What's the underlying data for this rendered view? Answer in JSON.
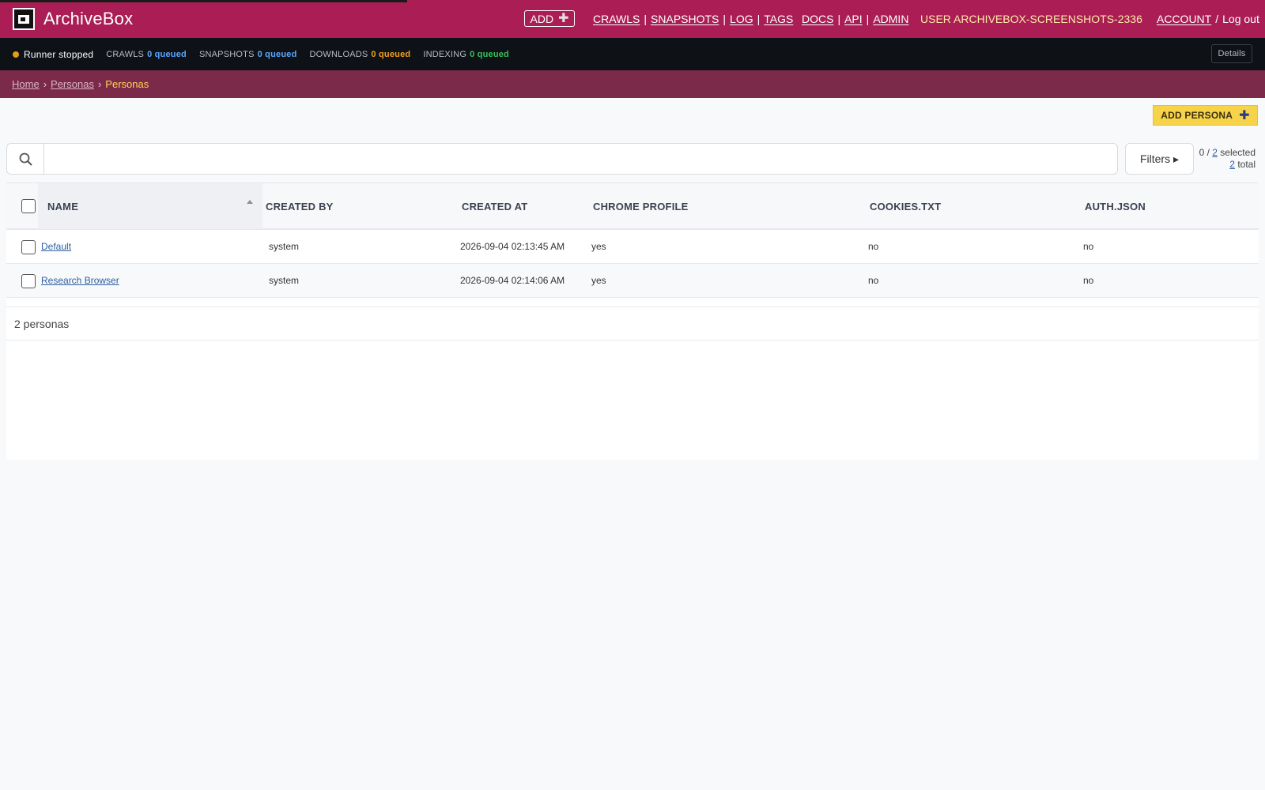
{
  "header": {
    "brand": "ArchiveBox",
    "add_label": "ADD",
    "nav_group1": [
      "CRAWLS",
      "SNAPSHOTS",
      "LOG",
      "TAGS"
    ],
    "nav_group2": [
      "DOCS",
      "API",
      "ADMIN"
    ],
    "user": "USER ARCHIVEBOX-SCREENSHOTS-2336",
    "account": "ACCOUNT",
    "logout_sep": "/",
    "logout": "Log out"
  },
  "status": {
    "runner": "Runner stopped",
    "queues": [
      {
        "label": "CRAWLS",
        "value": "0 queued",
        "color": "#5aa7ff"
      },
      {
        "label": "SNAPSHOTS",
        "value": "0 queued",
        "color": "#5aa7ff"
      },
      {
        "label": "DOWNLOADS",
        "value": "0 queued",
        "color": "#f0a020"
      },
      {
        "label": "INDEXING",
        "value": "0 queued",
        "color": "#36c05c"
      }
    ],
    "details": "Details"
  },
  "breadcrumb": {
    "home": "Home",
    "personas": "Personas",
    "current": "Personas",
    "sep": "›"
  },
  "toolbar": {
    "add_persona": "ADD PERSONA",
    "search_value": "",
    "filters": "Filters ▸",
    "selected_count": "0",
    "selected_of": "2",
    "selected_suffix": "selected",
    "total_count": "2",
    "total_suffix": "total"
  },
  "table": {
    "columns": [
      "NAME",
      "CREATED BY",
      "CREATED AT",
      "CHROME PROFILE",
      "COOKIES.TXT",
      "AUTH.JSON"
    ],
    "rows": [
      {
        "name": "Default",
        "created_by": "system",
        "created_at": "2026-09-04 02:13:45 AM",
        "chrome_profile": "yes",
        "cookies": "no",
        "auth": "no"
      },
      {
        "name": "Research Browser",
        "created_by": "system",
        "created_at": "2026-09-04 02:14:06 AM",
        "chrome_profile": "yes",
        "cookies": "no",
        "auth": "no"
      }
    ],
    "footer": "2 personas"
  },
  "colors": {
    "header_bg": "#aa1e55",
    "status_bg": "#0e1116",
    "breadcrumb_bg": "#7c2a4a",
    "accent_button": "#f7d34a",
    "link": "#2d5fa0"
  },
  "icons": {
    "logo": "archivebox-logo-icon",
    "add": "plus-icon",
    "search": "search-icon",
    "sort": "sort-asc-icon"
  }
}
